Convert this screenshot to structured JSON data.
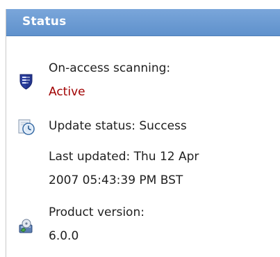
{
  "status_panel": {
    "title": "Status",
    "on_access": {
      "label": "On-access scanning:",
      "value": "Active",
      "value_color": "#a00000",
      "icon": "shield-icon"
    },
    "update": {
      "label": "Update status: Success",
      "last_updated_line1": "Last updated: Thu 12 Apr",
      "last_updated_line2": "2007 05:43:39 PM BST",
      "icon": "clock-icon"
    },
    "product": {
      "label": "Product version:",
      "value": "6.0.0",
      "icon": "product-icon"
    }
  }
}
